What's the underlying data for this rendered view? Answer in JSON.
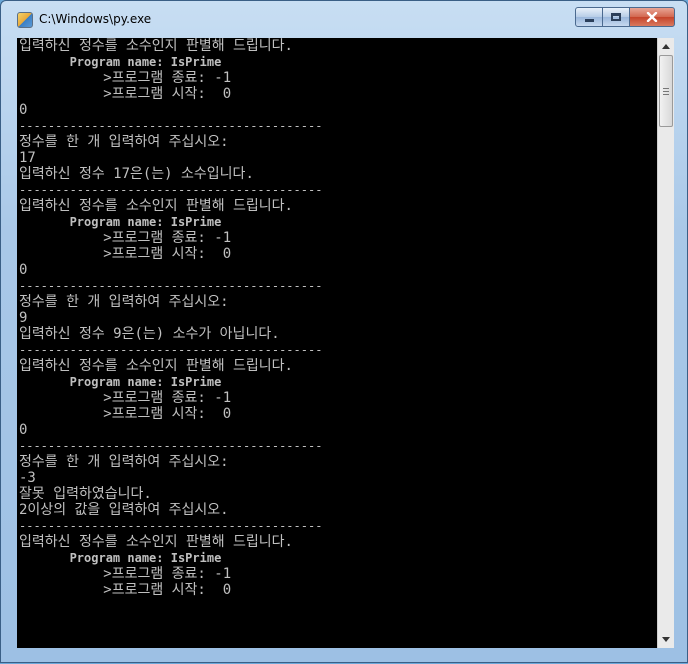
{
  "window": {
    "title": "C:\\Windows\\py.exe"
  },
  "console": {
    "lines": [
      {
        "text": "입력하신 정수를 소수인지 판별해 드립니다.",
        "style": "normal"
      },
      {
        "text": "       Program name: IsPrime",
        "style": "bold"
      },
      {
        "text": "          >프로그램 종료: -1",
        "style": "normal"
      },
      {
        "text": "          >프로그램 시작:  0",
        "style": "normal"
      },
      {
        "text": "0",
        "style": "normal"
      },
      {
        "text": "------------------------------------------",
        "style": "sep"
      },
      {
        "text": "정수를 한 개 입력하여 주십시오:",
        "style": "normal"
      },
      {
        "text": "17",
        "style": "normal"
      },
      {
        "text": "입력하신 정수 17은(는) 소수입니다.",
        "style": "normal"
      },
      {
        "text": "------------------------------------------",
        "style": "sep"
      },
      {
        "text": "입력하신 정수를 소수인지 판별해 드립니다.",
        "style": "normal"
      },
      {
        "text": "       Program name: IsPrime",
        "style": "bold"
      },
      {
        "text": "          >프로그램 종료: -1",
        "style": "normal"
      },
      {
        "text": "          >프로그램 시작:  0",
        "style": "normal"
      },
      {
        "text": "0",
        "style": "normal"
      },
      {
        "text": "------------------------------------------",
        "style": "sep"
      },
      {
        "text": "정수를 한 개 입력하여 주십시오:",
        "style": "normal"
      },
      {
        "text": "9",
        "style": "normal"
      },
      {
        "text": "입력하신 정수 9은(는) 소수가 아닙니다.",
        "style": "normal"
      },
      {
        "text": "------------------------------------------",
        "style": "sep"
      },
      {
        "text": "입력하신 정수를 소수인지 판별해 드립니다.",
        "style": "normal"
      },
      {
        "text": "       Program name: IsPrime",
        "style": "bold"
      },
      {
        "text": "          >프로그램 종료: -1",
        "style": "normal"
      },
      {
        "text": "          >프로그램 시작:  0",
        "style": "normal"
      },
      {
        "text": "0",
        "style": "normal"
      },
      {
        "text": "------------------------------------------",
        "style": "sep"
      },
      {
        "text": "정수를 한 개 입력하여 주십시오:",
        "style": "normal"
      },
      {
        "text": "-3",
        "style": "normal"
      },
      {
        "text": "잘못 입력하였습니다.",
        "style": "normal"
      },
      {
        "text": "2이상의 값을 입력하여 주십시오.",
        "style": "normal"
      },
      {
        "text": "------------------------------------------",
        "style": "sep"
      },
      {
        "text": "입력하신 정수를 소수인지 판별해 드립니다.",
        "style": "normal"
      },
      {
        "text": "       Program name: IsPrime",
        "style": "bold"
      },
      {
        "text": "          >프로그램 종료: -1",
        "style": "normal"
      },
      {
        "text": "          >프로그램 시작:  0",
        "style": "normal"
      }
    ]
  },
  "scrollbar": {
    "up_icon": "arrow-up-icon",
    "down_icon": "arrow-down-icon"
  },
  "colors": {
    "console_bg": "#000000",
    "console_fg": "#c0c0c0",
    "close_button": "#c5432a"
  }
}
